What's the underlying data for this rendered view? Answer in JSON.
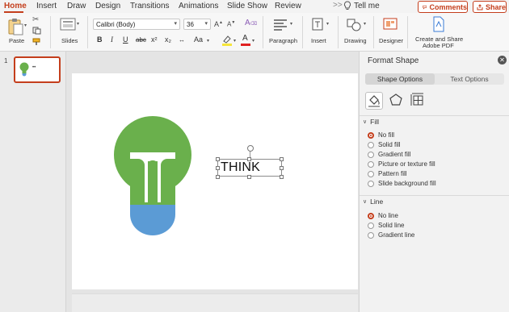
{
  "tabs": [
    "Home",
    "Insert",
    "Draw",
    "Design",
    "Transitions",
    "Animations",
    "Slide Show",
    "Review"
  ],
  "more_label": ">>",
  "tell_me": "Tell me",
  "comments_label": "Comments",
  "share_label": "Share",
  "ribbon": {
    "paste": "Paste",
    "slides": "Slides",
    "font_name": "Calibri (Body)",
    "font_size": "36",
    "bold": "B",
    "italic": "I",
    "underline": "U",
    "strike": "abc",
    "superscript": "x²",
    "subscript": "x₂",
    "change_case": "Aa",
    "paragraph": "Paragraph",
    "insert": "Insert",
    "drawing": "Drawing",
    "designer": "Designer",
    "create_share_line1": "Create and Share",
    "create_share_line2": "Adobe PDF"
  },
  "thumbnails": [
    {
      "number": "1",
      "caption": "••"
    }
  ],
  "slide": {
    "textbox_text": "THINK",
    "bulb_green": "#6ab04c",
    "bulb_blue": "#5b9bd5"
  },
  "format_pane": {
    "title": "Format Shape",
    "tab_shape": "Shape Options",
    "tab_text": "Text Options",
    "fill_header": "Fill",
    "fill_options": [
      "No fill",
      "Solid fill",
      "Gradient fill",
      "Picture or texture fill",
      "Pattern fill",
      "Slide background fill"
    ],
    "line_header": "Line",
    "line_options": [
      "No line",
      "Solid line",
      "Gradient line"
    ]
  },
  "colors": {
    "accent": "#c43e1c"
  }
}
